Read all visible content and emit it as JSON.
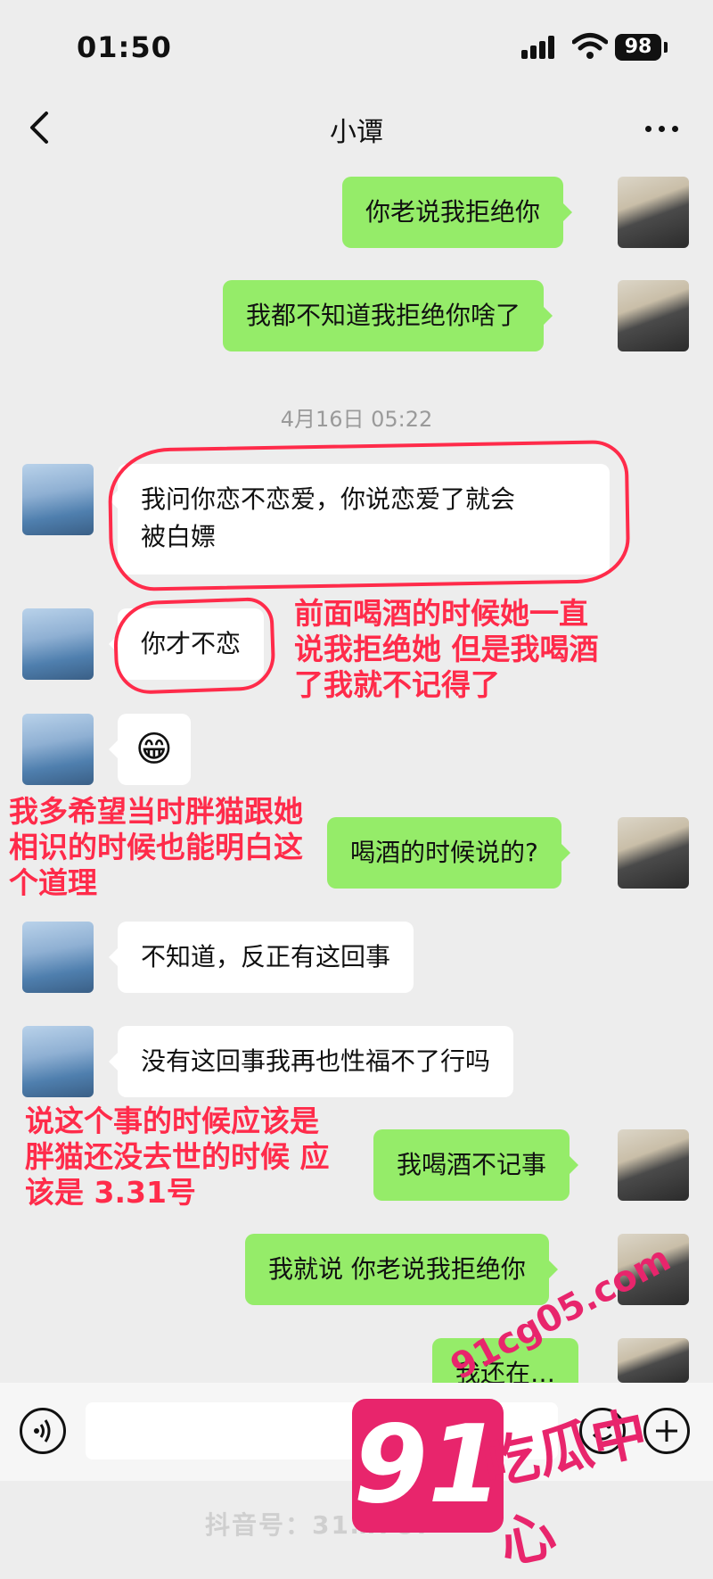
{
  "status_bar": {
    "time": "01:50",
    "battery": "98"
  },
  "header": {
    "title": "小谭"
  },
  "timestamp": "4月16日 05:22",
  "messages": [
    {
      "side": "out",
      "text": "你老说我拒绝你"
    },
    {
      "side": "out",
      "text": "我都不知道我拒绝你啥了"
    },
    {
      "side": "in",
      "line1": "我问你恋不恋爱，你说恋爱了就会",
      "line2": "被白嫖"
    },
    {
      "side": "in",
      "text": "你才不恋"
    },
    {
      "side": "in",
      "text": "😁"
    },
    {
      "side": "out",
      "text": "喝酒的时候说的?"
    },
    {
      "side": "in",
      "text": "不知道，反正有这回事"
    },
    {
      "side": "in",
      "text": "没有这回事我再也性福不了行吗"
    },
    {
      "side": "out",
      "text": "我喝酒不记事"
    },
    {
      "side": "out",
      "text": "我就说 你老说我拒绝你"
    },
    {
      "side": "out",
      "text": "我还在…"
    }
  ],
  "annotations": {
    "a1": "前面喝酒的时候她一直\n说我拒绝她 但是我喝酒\n了我就不记得了",
    "a2": "我多希望当时胖猫跟她\n相识的时候也能明白这\n个道理",
    "a3": "说这个事的时候应该是\n胖猫还没去世的时候 应\n该是 3.31号"
  },
  "watermark": {
    "douyin_id": "抖音号：31…787",
    "logo_number": "91",
    "logo_text": "吃瓜中心",
    "logo_url": "91cg05.com"
  },
  "colors": {
    "outgoing_bubble": "#95ec69",
    "incoming_bubble": "#ffffff",
    "annotation_red": "#ff2b4a",
    "background": "#ededed"
  }
}
